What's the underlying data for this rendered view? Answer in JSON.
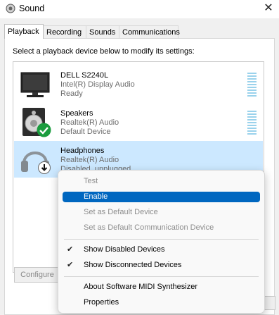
{
  "window": {
    "title": "Sound",
    "close_glyph": "✕"
  },
  "tabs": [
    {
      "label": "Playback",
      "active": true
    },
    {
      "label": "Recording"
    },
    {
      "label": "Sounds"
    },
    {
      "label": "Communications"
    }
  ],
  "instructions": "Select a playback device below to modify its settings:",
  "devices": [
    {
      "name": "DELL S2240L",
      "driver": "Intel(R) Display Audio",
      "status": "Ready",
      "icon": "monitor-icon"
    },
    {
      "name": "Speakers",
      "driver": "Realtek(R) Audio",
      "status": "Default Device",
      "icon": "speaker-icon",
      "badge": "default-check-icon"
    },
    {
      "name": "Headphones",
      "driver": "Realtek(R) Audio",
      "status": "Disabled, unplugged",
      "icon": "headphones-icon",
      "badge": "disabled-arrow-icon",
      "selected": true
    }
  ],
  "buttons": {
    "configure": "Configure"
  },
  "context_menu": {
    "test": "Test",
    "enable": "Enable",
    "set_default": "Set as Default Device",
    "set_default_comm": "Set as Default Communication Device",
    "show_disabled": "Show Disabled Devices",
    "show_disconnected": "Show Disconnected Devices",
    "about_midi": "About Software MIDI Synthesizer",
    "properties": "Properties",
    "check_glyph": "✔"
  },
  "colors": {
    "selection": "#cce8ff",
    "menu_highlight": "#0067c0",
    "check_badge": "#1a9c3e"
  }
}
